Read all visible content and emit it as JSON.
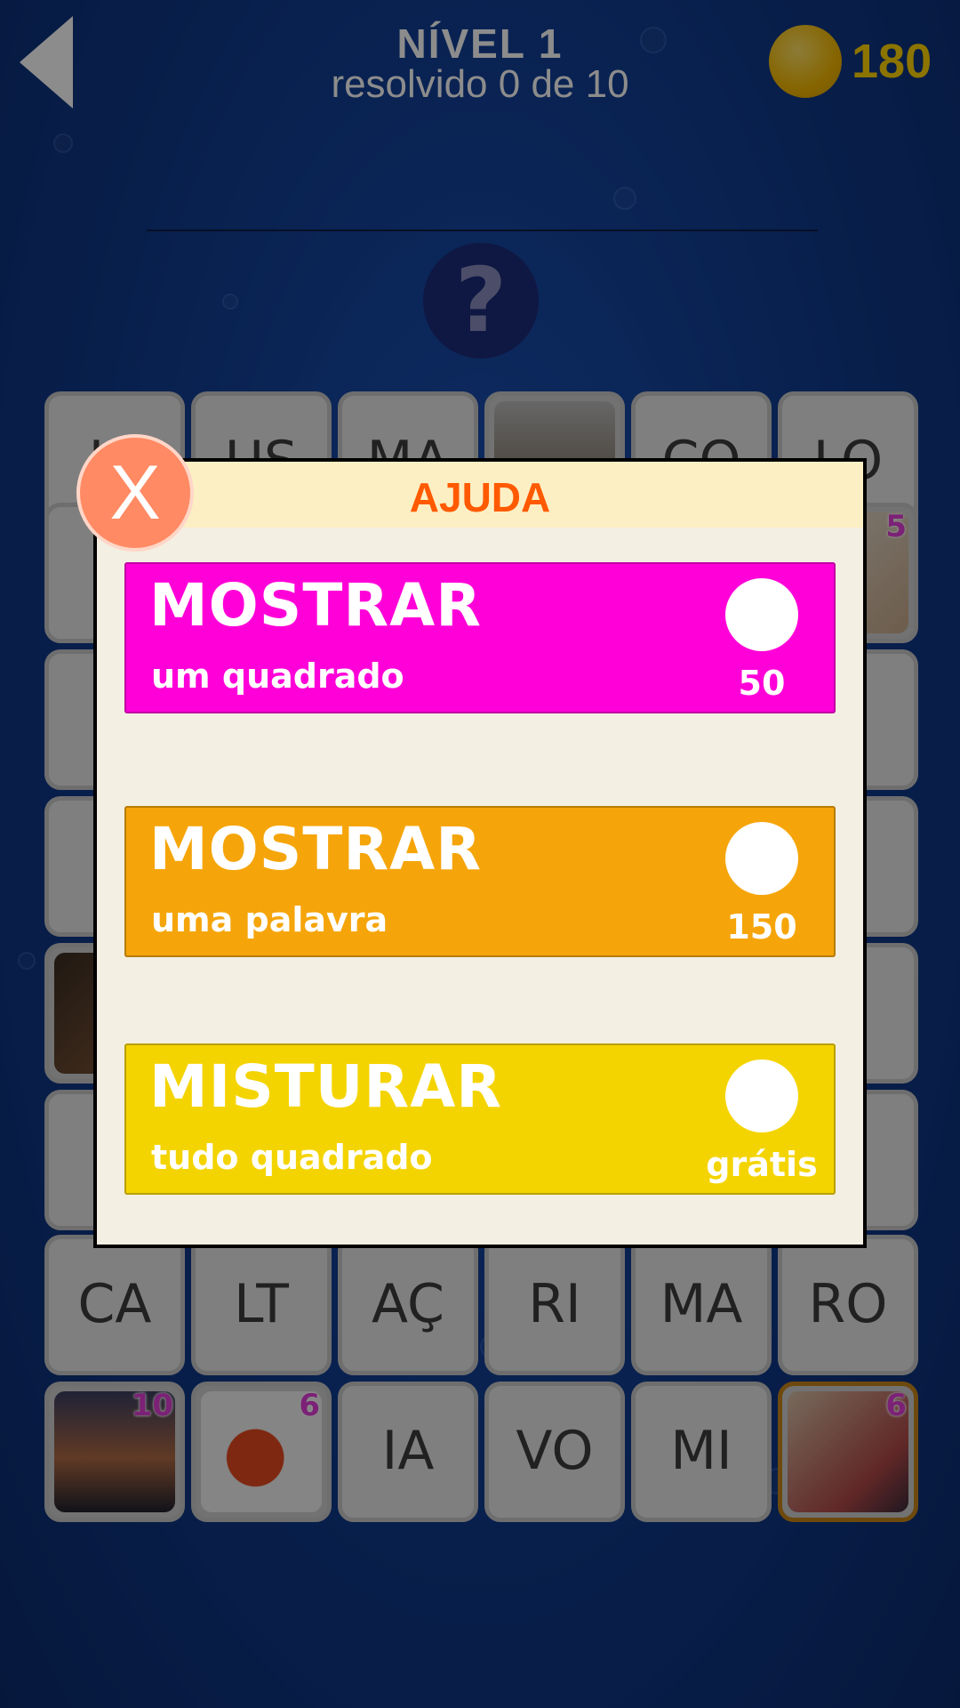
{
  "header": {
    "level_title": "NÍVEL 1",
    "progress_text": "resolvido 0 de 10",
    "coins": "180"
  },
  "grid": {
    "top_partial": [
      "IA",
      "US",
      "MA",
      "",
      "CO",
      "LO"
    ],
    "row_ca": [
      "CA",
      "LT",
      "AÇ",
      "RI",
      "MA",
      "RO"
    ],
    "row_bottom": [
      {
        "type": "photo",
        "badge": "10"
      },
      {
        "type": "photo",
        "badge": "6"
      },
      {
        "type": "text",
        "text": "IA"
      },
      {
        "type": "text",
        "text": "VO"
      },
      {
        "type": "text",
        "text": "MI"
      },
      {
        "type": "photo",
        "badge": "6"
      }
    ],
    "right_badge": "5"
  },
  "dialog": {
    "title": "AJUDA",
    "close_label": "X",
    "options": [
      {
        "title": "MOSTRAR",
        "desc": "um quadrado",
        "price": "50",
        "color": "#ff00d8"
      },
      {
        "title": "MOSTRAR",
        "desc": "uma palavra",
        "price": "150",
        "color": "#f5a50a"
      },
      {
        "title": "MISTURAR",
        "desc": "tudo quadrado",
        "price": "grátis",
        "color": "#f4d400"
      }
    ]
  }
}
